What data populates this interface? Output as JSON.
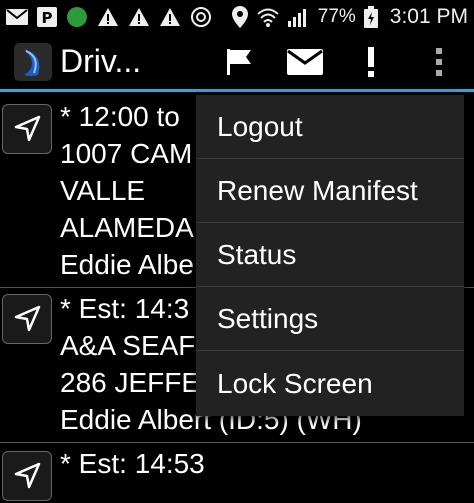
{
  "status_bar": {
    "battery_percent": "77%",
    "time": "3:01 PM",
    "left_icons": [
      "mail-icon",
      "p-icon",
      "green-dot-icon",
      "warning-icon",
      "warning-icon",
      "warning-icon",
      "power-icon"
    ],
    "right_icons": [
      "location-icon",
      "wifi-icon",
      "signal-icon",
      "battery-icon"
    ]
  },
  "action_bar": {
    "title": "Driv...",
    "accent_color": "#33a8d8",
    "actions": [
      "flag-icon",
      "mail-icon",
      "exclamation-icon",
      "overflow-icon"
    ]
  },
  "stops": [
    {
      "lines": [
        "* 12:00 to",
        "1007 CAM",
        "VALLE",
        "ALAMEDA",
        "Eddie Albe"
      ]
    },
    {
      "lines": [
        "* Est: 14:3",
        "A&A SEAF",
        "286 JEFFE",
        "Eddie Albert (ID:5) (WH)"
      ]
    },
    {
      "lines": [
        "* Est: 14:53",
        ""
      ]
    }
  ],
  "menu": {
    "items": [
      "Logout",
      "Renew Manifest",
      "Status",
      "Settings",
      "Lock Screen"
    ]
  }
}
